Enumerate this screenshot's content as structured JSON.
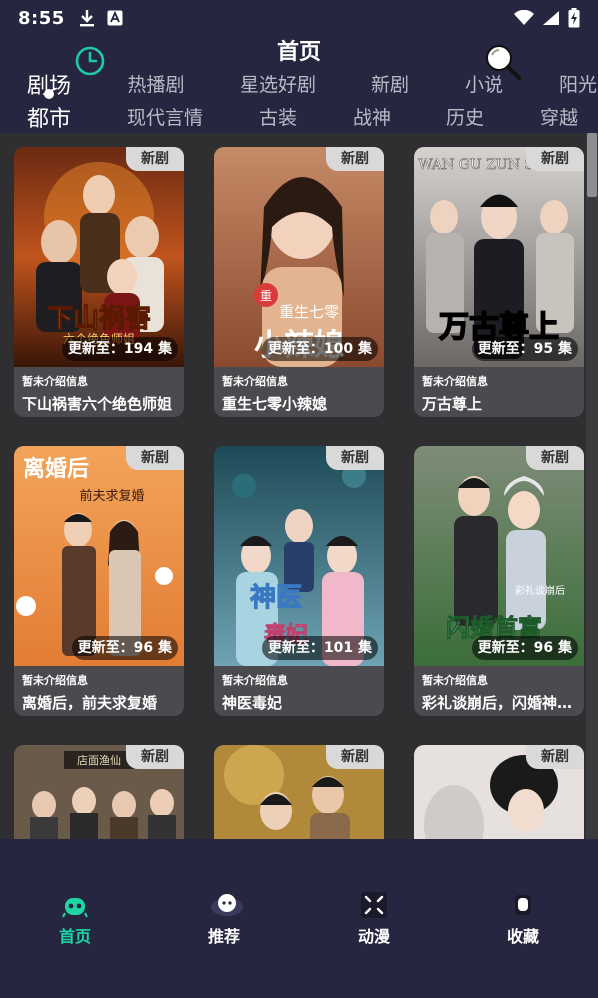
{
  "status_bar": {
    "time": "8:55",
    "left_icons": [
      "download-icon",
      "app-notification-icon"
    ],
    "right_icons": [
      "wifi-icon",
      "signal-icon",
      "battery-charging-icon"
    ]
  },
  "header": {
    "title": "首页",
    "history_icon": "clock-icon",
    "search_icon": "search-icon"
  },
  "tabs_row1": [
    {
      "label": "剧场",
      "active": true
    },
    {
      "label": "热播剧",
      "active": false
    },
    {
      "label": "星选好剧",
      "active": false
    },
    {
      "label": "新剧",
      "active": false
    },
    {
      "label": "小说",
      "active": false
    },
    {
      "label": "阳光",
      "active": false
    }
  ],
  "tabs_row2": [
    {
      "label": "都市",
      "active": true
    },
    {
      "label": "现代言情",
      "active": false
    },
    {
      "label": "古装",
      "active": false
    },
    {
      "label": "战神",
      "active": false
    },
    {
      "label": "历史",
      "active": false
    },
    {
      "label": "穿越",
      "active": false
    }
  ],
  "cards": [
    {
      "badge": "新剧",
      "update": "更新至：194 集",
      "intro": "暂未介绍信息",
      "title": "下山祸害六个绝色师姐"
    },
    {
      "badge": "新剧",
      "update": "更新至：100 集",
      "intro": "暂未介绍信息",
      "title": "重生七零小辣媳"
    },
    {
      "badge": "新剧",
      "update": "更新至：95 集",
      "intro": "暂未介绍信息",
      "title": "万古尊上"
    },
    {
      "badge": "新剧",
      "update": "更新至：96 集",
      "intro": "暂未介绍信息",
      "title": "离婚后，前夫求复婚"
    },
    {
      "badge": "新剧",
      "update": "更新至：101 集",
      "intro": "暂未介绍信息",
      "title": "神医毒妃"
    },
    {
      "badge": "新剧",
      "update": "更新至：96 集",
      "intro": "暂未介绍信息",
      "title": "彩礼谈崩后，闪婚神秘首富"
    },
    {
      "badge": "新剧",
      "update": "",
      "intro": "",
      "title": ""
    },
    {
      "badge": "新剧",
      "update": "",
      "intro": "",
      "title": ""
    },
    {
      "badge": "新剧",
      "update": "",
      "intro": "",
      "title": ""
    }
  ],
  "poster_text": {
    "p1": "下山祸害",
    "p1b": "六个绝色师姐",
    "p2": "重生七零",
    "p2b": "小辣媳",
    "p3": "万古尊上",
    "p3top": "WAN GU ZUN SHANG",
    "p4": "离婚后",
    "p4b": "前夫求复婚",
    "p5": "神医",
    "p5b": "毒妃",
    "p6": "闪婚首富",
    "p6b": "彩礼谈崩后",
    "p7": "店面渔仙"
  },
  "bottom_nav": [
    {
      "label": "首页",
      "icon": "home-icon",
      "active": true
    },
    {
      "label": "推荐",
      "icon": "recommend-icon",
      "active": false
    },
    {
      "label": "动漫",
      "icon": "anime-icon",
      "active": false
    },
    {
      "label": "收藏",
      "icon": "favorites-icon",
      "active": false
    }
  ],
  "colors": {
    "header_bg": "#262640",
    "content_bg": "#2f2f31",
    "card_bg": "#4b4a4f",
    "accent": "#1ed6a3"
  }
}
